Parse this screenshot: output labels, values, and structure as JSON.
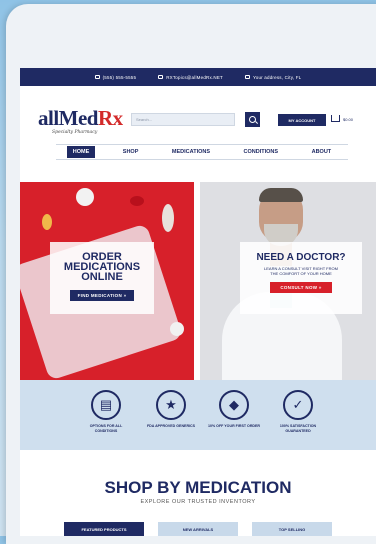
{
  "topbar": {
    "phone": "(555) 555-5555",
    "email": "RXTopics@allMedRx.NET",
    "address": "Your address, City, FL"
  },
  "logo": {
    "name_main": "allMed",
    "name_accent": "Rx",
    "tagline": "Specialty Pharmacy"
  },
  "search": {
    "placeholder": "Search..."
  },
  "account": {
    "label": "MY ACCOUNT"
  },
  "cart": {
    "total": "$0.00"
  },
  "nav": {
    "items": [
      "HOME",
      "SHOP",
      "MEDICATIONS",
      "CONDITIONS",
      "ABOUT"
    ],
    "active": "HOME"
  },
  "hero_left": {
    "title": "ORDER MEDICATIONS ONLINE",
    "button": "FIND MEDICATION »"
  },
  "hero_right": {
    "title": "NEED A DOCTOR?",
    "subtitle": "LEARN A CONSULT VISIT RIGHT FROM THE COMFORT OF YOUR HOME",
    "button": "CONSULT NOW »"
  },
  "features": [
    {
      "icon": "clipboard-icon",
      "label": "OPTIONS FOR ALL CONDITIONS"
    },
    {
      "icon": "star-icon",
      "label": "FDA APPROVED GENERICS"
    },
    {
      "icon": "tag-icon",
      "label": "10% OFF YOUR FIRST ORDER"
    },
    {
      "icon": "check-icon",
      "label": "100% SATISFACTION GUARANTEED"
    }
  ],
  "shop": {
    "title": "SHOP BY MEDICATION",
    "subtitle": "EXPLORE OUR TRUSTED INVENTORY",
    "tabs": [
      "FEATURED PRODUCTS",
      "NEW ARRIVALS",
      "TOP SELLING"
    ]
  },
  "colors": {
    "brand_navy": "#1f2a63",
    "accent_red": "#d7202a",
    "band_blue": "#cfdfee"
  }
}
